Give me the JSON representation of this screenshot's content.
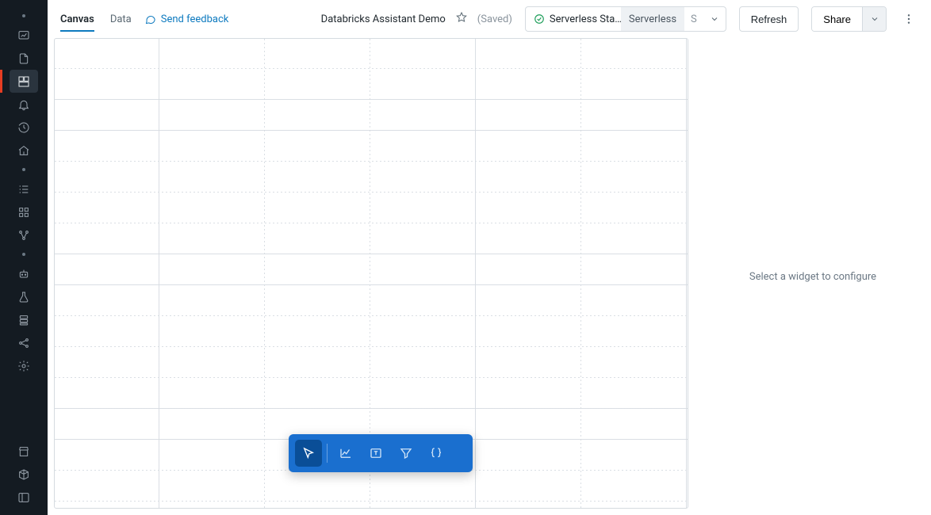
{
  "sidebar": {
    "items": [
      {
        "name": "dashboard-icon"
      },
      {
        "name": "file-icon"
      },
      {
        "name": "dashboards-icon",
        "active": true
      },
      {
        "name": "alerts-icon"
      },
      {
        "name": "history-icon"
      },
      {
        "name": "warehouse-icon"
      },
      {
        "name": "sql-editor-icon"
      },
      {
        "name": "queries-icon"
      },
      {
        "name": "lineage-icon"
      },
      {
        "name": "store-icon"
      },
      {
        "name": "experiments-icon"
      },
      {
        "name": "catalog-icon"
      },
      {
        "name": "workflows-icon"
      },
      {
        "name": "marketplace-icon"
      },
      {
        "name": "partner-connect-icon"
      },
      {
        "name": "collapse-icon"
      }
    ]
  },
  "tabs": {
    "canvas": "Canvas",
    "data": "Data"
  },
  "feedback_label": "Send feedback",
  "title": "Databricks Assistant Demo",
  "saved_label": "(Saved)",
  "compute": {
    "status_label": "Serverless Sta…",
    "env_label": "Serverless",
    "env_short": "S"
  },
  "buttons": {
    "refresh": "Refresh",
    "share": "Share"
  },
  "right_panel": {
    "placeholder": "Select a widget to configure"
  },
  "widget_toolbar": {
    "tools": [
      {
        "name": "pointer-tool",
        "active": true
      },
      {
        "name": "add-chart-tool"
      },
      {
        "name": "add-text-tool"
      },
      {
        "name": "add-filter-tool"
      },
      {
        "name": "add-parameter-tool"
      }
    ]
  }
}
